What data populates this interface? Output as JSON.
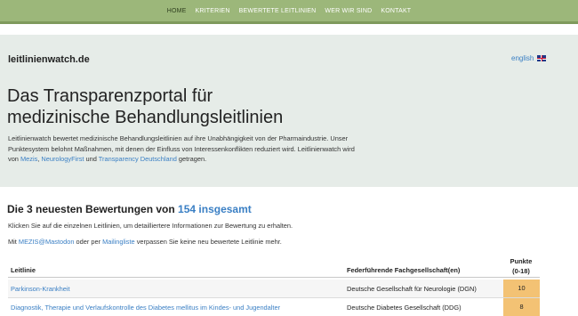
{
  "nav": {
    "items": [
      {
        "label": "HOME",
        "active": true
      },
      {
        "label": "KRITERIEN",
        "active": false
      },
      {
        "label": "BEWERTETE LEITLINIEN",
        "active": false
      },
      {
        "label": "WER WIR SIND",
        "active": false
      },
      {
        "label": "KONTAKT",
        "active": false
      }
    ]
  },
  "header": {
    "site_name": "leitlinienwatch.de",
    "lang_label": "english",
    "lang_icon": "uk-flag-icon"
  },
  "hero": {
    "title_line1": "Das Transparenzportal für",
    "title_line2": "medizinische Behandlungsleitlinien",
    "intro_part1": "Leitlinienwatch bewertet medizinische Behandlungsleitlinien auf ihre Unabhängigkeit von der Pharmaindustrie. Unser Punktesystem belohnt Maßnahmen, mit denen der Einfluss von Interessenkonflikten reduziert wird. Leitlinienwatch wird von ",
    "link_mezis": "Mezis",
    "sep1": ", ",
    "link_neurology": "NeurologyFirst",
    "sep2": " und ",
    "link_transparency": "Transparency Deutschland",
    "intro_end": " getragen."
  },
  "latest": {
    "title_prefix": "Die 3 neuesten Bewertungen von ",
    "title_link": "154 insgesamt",
    "click_hint": "Klicken Sie auf die einzelnen Leitlinien, um detailliertere Informationen zur Bewertung zu erhalten.",
    "follow_prefix": "Mit ",
    "follow_link1": "MEZIS@Mastodon",
    "follow_mid": " oder per ",
    "follow_link2": "Mailingliste",
    "follow_end": " verpassen Sie keine neu bewertete Leitlinie mehr."
  },
  "table": {
    "col_title": "Leitlinie",
    "col_society": "Federführende Fachgesellschaft(en)",
    "col_points_1": "Punkte",
    "col_points_2": "(0-18)",
    "rows": [
      {
        "title": "Parkinson-Krankheit",
        "society": "Deutsche Gesellschaft für Neurologie (DGN)",
        "points": "10"
      },
      {
        "title": "Diagnostik, Therapie und Verlaufskontrolle des Diabetes mellitus im Kindes- und Jugendalter",
        "society": "Deutsche Diabetes Gesellschaft (DDG)",
        "points": "8"
      }
    ]
  },
  "colors": {
    "nav_bg": "#9cb77a",
    "hero_bg": "#e6ece8",
    "link": "#3a7fc4",
    "points_bg": "#f3c274"
  }
}
